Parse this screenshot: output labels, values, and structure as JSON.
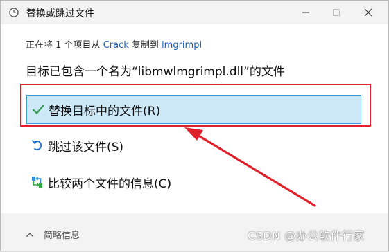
{
  "window": {
    "title": "替换或跳过文件",
    "icon": "clock-icon"
  },
  "titlebar_buttons": {
    "minimize_icon": "minimize-icon",
    "maximize_icon": "maximize-icon",
    "close_icon": "close-icon"
  },
  "status": {
    "prefix": "正在将 1 个项目从",
    "source": "Crack",
    "middle": "复制到",
    "destination": "lmgrimpl"
  },
  "heading": "目标已包含一个名为“libmwlmgrimpl.dll”的文件",
  "options": {
    "replace": {
      "label": "替换目标中的文件(R)",
      "icon": "checkmark-icon",
      "selected": true
    },
    "skip": {
      "label": "跳过该文件(S)",
      "icon": "undo-icon"
    },
    "compare": {
      "label": "比较两个文件的信息(C)",
      "icon": "compare-icon"
    }
  },
  "footer": {
    "toggle_label": "简略信息",
    "toggle_icon": "chevron-up-icon"
  },
  "watermark": "CSDN @办公软件行家",
  "colors": {
    "selection_bg": "#cce8f7",
    "selection_border": "#3f9bd6",
    "annotation_red": "#e0202a",
    "link_blue": "#1a5fb4"
  }
}
